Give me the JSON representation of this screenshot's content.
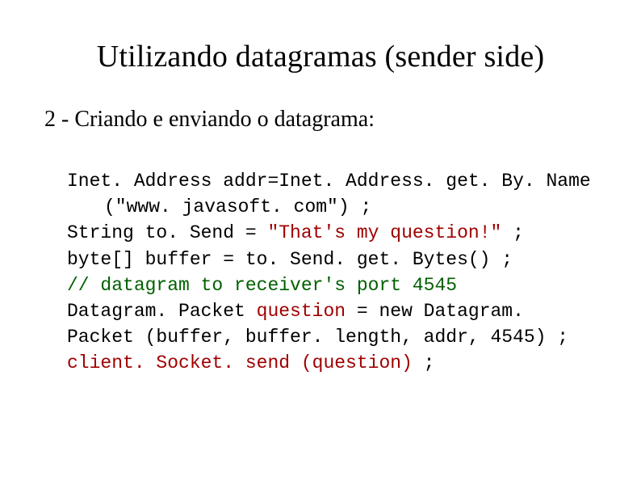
{
  "title": "Utilizando datagramas (sender side)",
  "subtitle": "2 - Criando e enviando o datagrama:",
  "code": {
    "l1": "Inet. Address addr=Inet. Address. get. By. Name",
    "l2": "(\"www. javasoft. com\") ;",
    "l3a": "String to. Send = ",
    "l3b": "\"That's my question!\"",
    "l3c": " ;",
    "l4": "byte[] buffer = to. Send. get. Bytes() ;",
    "l5a": "// datagram to receiver's port 4545",
    "l6a": "Datagram. Packet ",
    "l6b": "question",
    "l6c": " = new Datagram. Packet (buffer, buffer. length, addr, 4545) ;",
    "l7a": "client. Socket. send (question)",
    "l7b": " ;"
  }
}
